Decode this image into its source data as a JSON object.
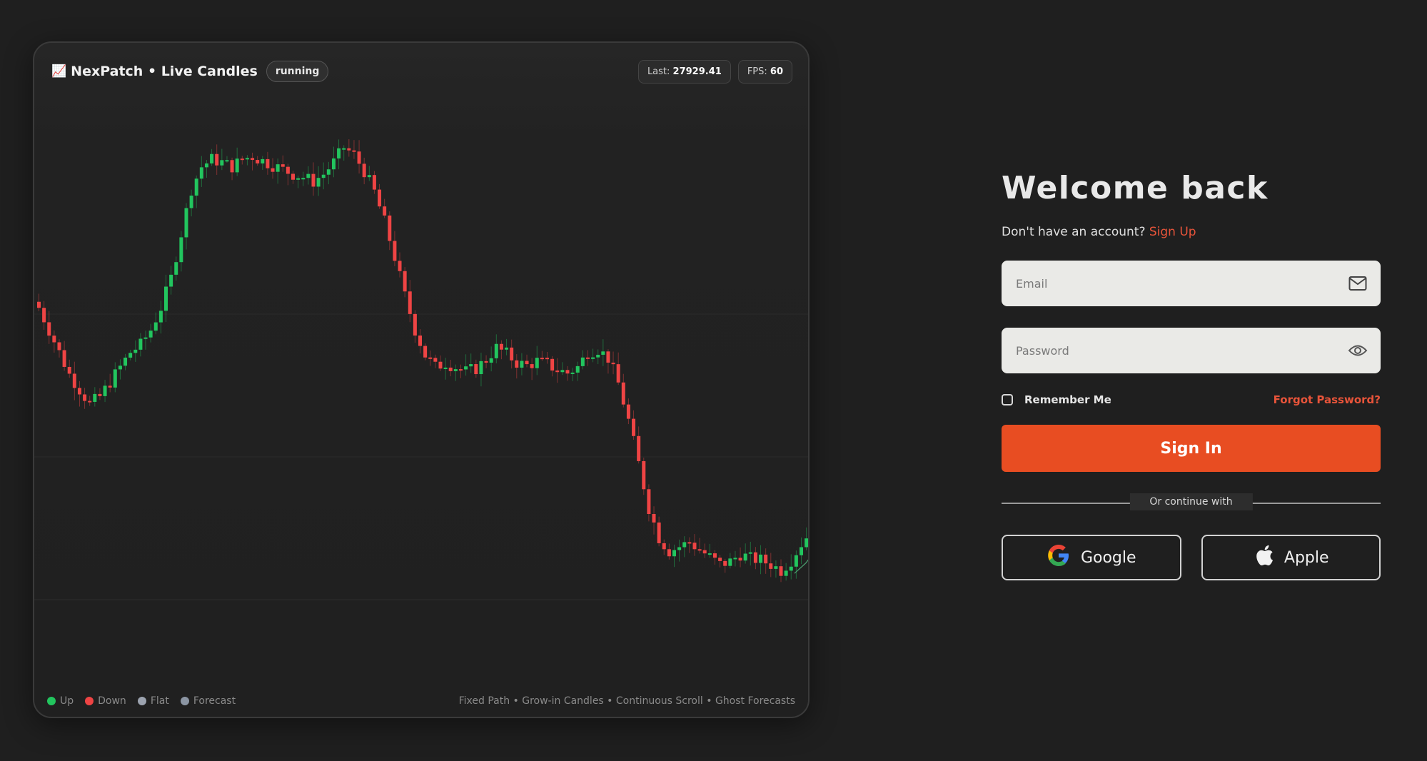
{
  "chart_panel": {
    "title_emoji": "📈",
    "title": "NexPatch • Live Candles",
    "status": "running",
    "last_label": "Last:",
    "last_value": "27929.41",
    "fps_label": "FPS:",
    "fps_value": "60",
    "legend": [
      {
        "label": "Up",
        "color": "#22c55e"
      },
      {
        "label": "Down",
        "color": "#ef4444"
      },
      {
        "label": "Flat",
        "color": "#9ca3af"
      },
      {
        "label": "Forecast",
        "color": "#8b95a3"
      }
    ],
    "footer_note": "Fixed Path • Grow-in Candles • Continuous Scroll • Ghost Forecasts"
  },
  "chart_data": {
    "type": "candlestick",
    "up_color": "#22c55e",
    "down_color": "#ef4444",
    "forecast_color": "#4a9a6e",
    "grid": true,
    "axes_visible": false,
    "close_path": [
      29300,
      29150,
      29000,
      28850,
      28750,
      28650,
      28700,
      28800,
      28900,
      29000,
      29050,
      29150,
      29300,
      29500,
      29800,
      30100,
      30250,
      30300,
      30280,
      30250,
      30300,
      30320,
      30290,
      30260,
      30230,
      30200,
      30180,
      30150,
      30200,
      30280,
      30380,
      30330,
      30220,
      30080,
      29880,
      29640,
      29380,
      29150,
      28980,
      28900,
      28930,
      28900,
      28870,
      28890,
      28950,
      29030,
      28990,
      28930,
      28910,
      28940,
      28920,
      28880,
      28860,
      28900,
      29000,
      29020,
      28960,
      28790,
      28540,
      28250,
      27950,
      27750,
      27660,
      27690,
      27720,
      27670,
      27620,
      27570,
      27590,
      27640,
      27610,
      27600,
      27570,
      27530,
      27600,
      27710,
      27800,
      27900
    ],
    "forecast_path": [
      27510,
      27580,
      27680,
      27900,
      28150,
      28330,
      28380,
      28320,
      28290,
      28330,
      28250
    ]
  },
  "login": {
    "heading": "Welcome back",
    "subtitle": "Don't have an account?",
    "signup_link": "Sign Up",
    "email_placeholder": "Email",
    "password_placeholder": "Password",
    "remember_label": "Remember Me",
    "forgot_link": "Forgot Password?",
    "signin_label": "Sign In",
    "divider_text": "Or continue with",
    "google_label": "Google",
    "apple_label": "Apple",
    "accent_color": "#e84d22"
  }
}
